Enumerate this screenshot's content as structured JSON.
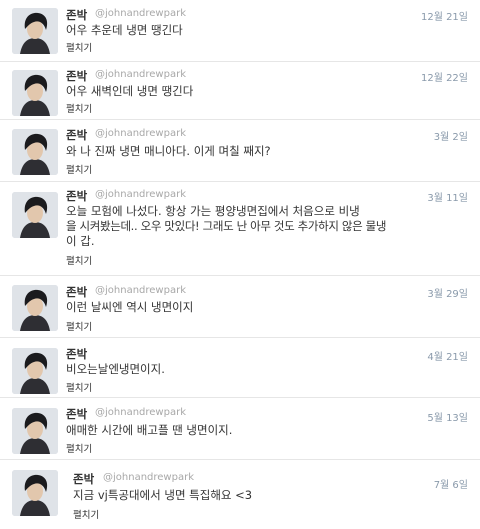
{
  "tweets": [
    {
      "name": "존박",
      "handle": "@johnandrewpark",
      "time": "12월 21일",
      "lines": [
        "어우 추운데 냉면 땡긴다"
      ],
      "expand": "펼치기"
    },
    {
      "name": "존박",
      "handle": "@johnandrewpark",
      "time": "12월 22일",
      "lines": [
        "어우 새벽인데 냉면 땡긴다"
      ],
      "expand": "펼치기"
    },
    {
      "name": "존박",
      "handle": "@johnandrewpark",
      "time": "3월 2일",
      "lines": [
        "와 나 진짜 냉면 매니아다. 이게 며칠 째지?"
      ],
      "expand": "펼치기"
    },
    {
      "name": "존박",
      "handle": "@johnandrewpark",
      "time": "3월 11일",
      "lines": [
        "오늘 모험에 나섰다. 항상 가는 평양냉면집에서 처음으로 비냉",
        "을 시켜봤는데.. 오우 맛있다! 그래도 난 아무 것도 추가하지 않은 물냉",
        "이 갑."
      ],
      "expand": "펼치기"
    },
    {
      "name": "존박",
      "handle": "@johnandrewpark",
      "time": "3월 29일",
      "lines": [
        "이런 날씨엔 역시 냉면이지"
      ],
      "expand": "펼치기"
    },
    {
      "name": "존박",
      "handle": "@johnandrewpark",
      "time": "4월 21일",
      "lines": [
        "비오는날엔냉면이지."
      ],
      "expand": "펼치기"
    },
    {
      "name": "존박",
      "handle": "@johnandrewpark",
      "time": "5월 13일",
      "lines": [
        "애매한 시간에 배고플 땐 냉면이지."
      ],
      "expand": "펼치기"
    },
    {
      "name": "존박",
      "handle": "@johnandrewpark",
      "time": "7월 6일",
      "lines": [
        "지금 vj특공대에서 냉면 특집해요 <3"
      ],
      "expand": "펼치기"
    }
  ]
}
